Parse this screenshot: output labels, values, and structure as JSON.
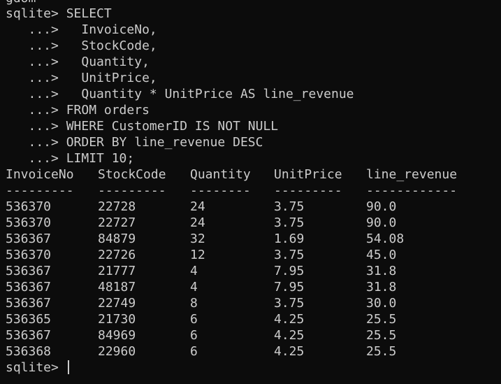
{
  "terminal": {
    "scrolled_top_fragment": "gdom",
    "query_lines": [
      "sqlite> SELECT",
      "   ...>   InvoiceNo,",
      "   ...>   StockCode,",
      "   ...>   Quantity,",
      "   ...>   UnitPrice,",
      "   ...>   Quantity * UnitPrice AS line_revenue",
      "   ...> FROM orders",
      "   ...> WHERE CustomerID IS NOT NULL",
      "   ...> ORDER BY line_revenue DESC",
      "   ...> LIMIT 10;"
    ],
    "result": {
      "headers": [
        "InvoiceNo",
        "StockCode",
        "Quantity",
        "UnitPrice",
        "line_revenue"
      ],
      "separators": [
        "---------",
        "---------",
        "--------",
        "---------",
        "------------"
      ],
      "rows": [
        [
          "536370",
          "22728",
          "24",
          "3.75",
          "90.0"
        ],
        [
          "536370",
          "22727",
          "24",
          "3.75",
          "90.0"
        ],
        [
          "536367",
          "84879",
          "32",
          "1.69",
          "54.08"
        ],
        [
          "536370",
          "22726",
          "12",
          "3.75",
          "45.0"
        ],
        [
          "536367",
          "21777",
          "4",
          "7.95",
          "31.8"
        ],
        [
          "536367",
          "48187",
          "4",
          "7.95",
          "31.8"
        ],
        [
          "536367",
          "22749",
          "8",
          "3.75",
          "30.0"
        ],
        [
          "536365",
          "21730",
          "6",
          "4.25",
          "25.5"
        ],
        [
          "536367",
          "84969",
          "6",
          "4.25",
          "25.5"
        ],
        [
          "536368",
          "22960",
          "6",
          "4.25",
          "25.5"
        ]
      ]
    },
    "final_prompt": "sqlite> "
  },
  "colors": {
    "background": "#0c0c0c",
    "foreground": "#cccccc"
  }
}
